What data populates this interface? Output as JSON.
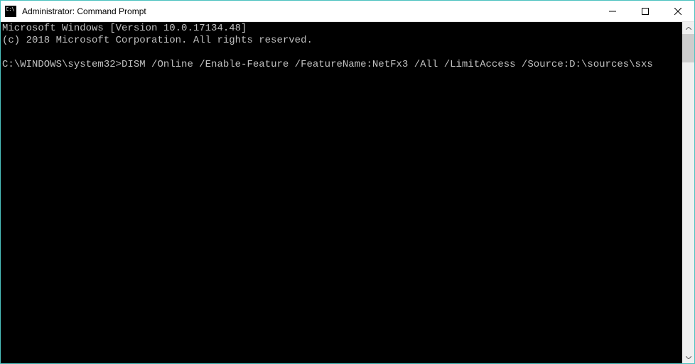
{
  "window": {
    "title": "Administrator: Command Prompt"
  },
  "terminal": {
    "line1": "Microsoft Windows [Version 10.0.17134.48]",
    "line2": "(c) 2018 Microsoft Corporation. All rights reserved.",
    "blank": "",
    "prompt": "C:\\WINDOWS\\system32>",
    "command": "DISM /Online /Enable-Feature /FeatureName:NetFx3 /All /LimitAccess /Source:D:\\sources\\sxs"
  }
}
